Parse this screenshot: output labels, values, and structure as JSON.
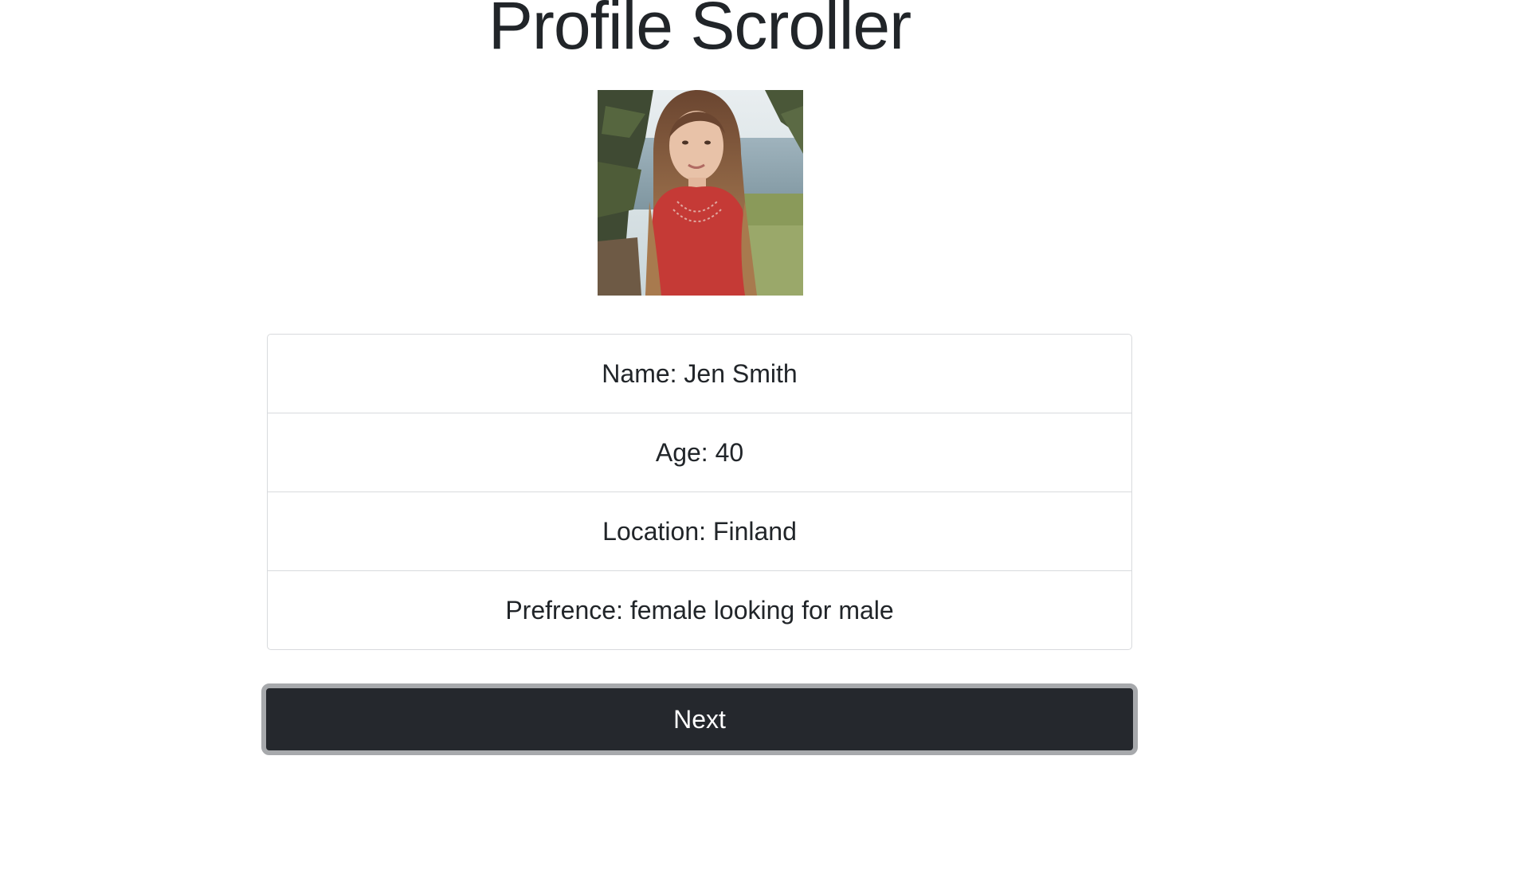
{
  "page": {
    "title": "Profile Scroller"
  },
  "profile": {
    "photo_alt": "Profile photo",
    "fields": [
      {
        "text": "Name: Jen Smith"
      },
      {
        "text": "Age: 40"
      },
      {
        "text": "Location: Finland"
      },
      {
        "text": "Prefrence: female looking for male"
      }
    ]
  },
  "actions": {
    "next_label": "Next"
  },
  "colors": {
    "button_bg": "#25282d",
    "button_border": "#a7a9ac",
    "list_border": "#d8dadd",
    "text": "#212529"
  }
}
